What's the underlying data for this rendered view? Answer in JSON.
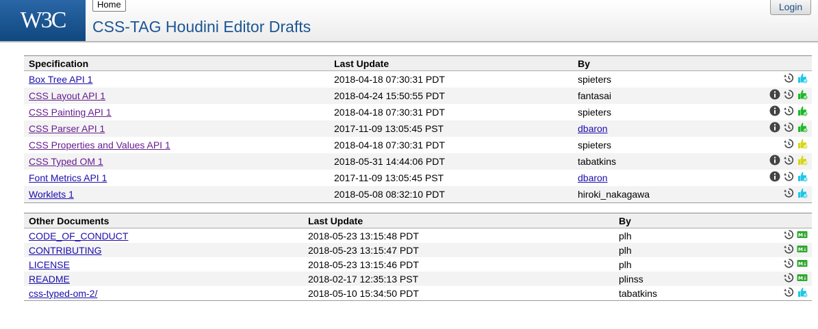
{
  "header": {
    "logo_text": "W3C",
    "home_label": "Home",
    "login_label": "Login",
    "title": "CSS-TAG Houdini Editor Drafts"
  },
  "specs": {
    "columns": [
      "Specification",
      "Last Update",
      "By"
    ],
    "rows": [
      {
        "name": "Box Tree API 1",
        "date": "2018-04-18 07:30:31 PDT",
        "by": "spieters",
        "by_link": false,
        "info": false,
        "status": "cyan",
        "visited": false
      },
      {
        "name": "CSS Layout API 1",
        "date": "2018-04-24 15:50:55 PDT",
        "by": "fantasai",
        "by_link": false,
        "info": true,
        "status": "green",
        "visited": true
      },
      {
        "name": "CSS Painting API 1",
        "date": "2018-04-18 07:30:31 PDT",
        "by": "spieters",
        "by_link": false,
        "info": true,
        "status": "green",
        "visited": true
      },
      {
        "name": "CSS Parser API 1",
        "date": "2017-11-09 13:05:45 PST",
        "by": "dbaron",
        "by_link": true,
        "info": true,
        "status": "green",
        "visited": true
      },
      {
        "name": "CSS Properties and Values API 1",
        "date": "2018-04-18 07:30:31 PDT",
        "by": "spieters",
        "by_link": false,
        "info": false,
        "status": "yellow",
        "visited": true
      },
      {
        "name": "CSS Typed OM 1",
        "date": "2018-05-31 14:44:06 PDT",
        "by": "tabatkins",
        "by_link": false,
        "info": true,
        "status": "yellow",
        "visited": true
      },
      {
        "name": "Font Metrics API 1",
        "date": "2017-11-09 13:05:45 PST",
        "by": "dbaron",
        "by_link": true,
        "info": true,
        "status": "cyan",
        "visited": false
      },
      {
        "name": "Worklets 1",
        "date": "2018-05-08 08:32:10 PDT",
        "by": "hiroki_nakagawa",
        "by_link": false,
        "info": false,
        "status": "cyan",
        "visited": false
      }
    ]
  },
  "others": {
    "columns": [
      "Other Documents",
      "Last Update",
      "By"
    ],
    "rows": [
      {
        "name": "CODE_OF_CONDUCT",
        "date": "2018-05-23 13:15:48 PDT",
        "by": "plh",
        "kind": "md"
      },
      {
        "name": "CONTRIBUTING",
        "date": "2018-05-23 13:15:47 PDT",
        "by": "plh",
        "kind": "md"
      },
      {
        "name": "LICENSE",
        "date": "2018-05-23 13:15:46 PDT",
        "by": "plh",
        "kind": "md"
      },
      {
        "name": "README",
        "date": "2018-02-17 12:35:13 PST",
        "by": "plinss",
        "kind": "md"
      },
      {
        "name": "css-typed-om-2/",
        "date": "2018-05-10 15:34:50 PDT",
        "by": "tabatkins",
        "kind": "cyan"
      }
    ]
  },
  "icon_names": {
    "info": "info-icon",
    "history": "history-icon",
    "status": "status-thumb-icon",
    "markdown": "markdown-icon"
  },
  "colors": {
    "brand_blue": "#1b5694",
    "status_green": "#1fb82a",
    "status_yellow": "#d6d61a",
    "status_cyan": "#1ec7e6",
    "md_green": "#2fa82f"
  }
}
